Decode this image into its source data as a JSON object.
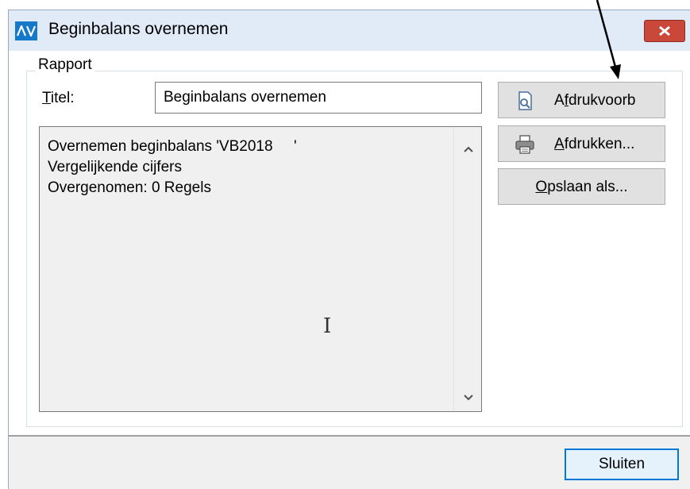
{
  "window": {
    "title": "Beginbalans overnemen",
    "app_icon_text": "AV",
    "close_glyph": "✕"
  },
  "group": {
    "label": "Rapport"
  },
  "title_field": {
    "label_accel": "T",
    "label_rest": "itel:",
    "value": "Beginbalans overnemen"
  },
  "report": {
    "lines": [
      "Overnemen beginbalans 'VB2018     '",
      "",
      "Vergelijkende cijfers",
      "Overgenomen: 0 Regels"
    ],
    "cursor_glyph": "I"
  },
  "buttons": {
    "print_preview": {
      "accel": "",
      "text_before": "A",
      "text_accel": "f",
      "text_after": "drukvoorb",
      "icon": "print-preview-icon"
    },
    "print": {
      "text_before": "",
      "text_accel": "A",
      "text_after": "fdrukken...",
      "icon": "printer-icon"
    },
    "save_as": {
      "text_before": "",
      "text_accel": "O",
      "text_after": "psl​aan als..."
    },
    "close": "Sluiten"
  },
  "colors": {
    "titlebar": "#e1ebf7",
    "app_icon": "#1479c8",
    "close_button": "#c9483a",
    "default_button_border": "#0078d7",
    "report_background": "#f0f0f0"
  }
}
